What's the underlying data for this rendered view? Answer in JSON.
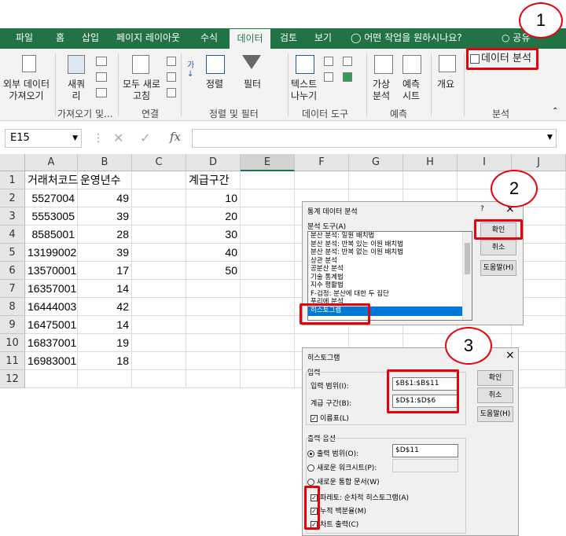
{
  "tabs": [
    "파일",
    "홈",
    "삽입",
    "페이지 레이아웃",
    "수식",
    "데이터",
    "검토",
    "보기"
  ],
  "tell_me": "어떤 작업을 원하시나요?",
  "share": "공유",
  "ribbon": {
    "external_data": "외부 데이터\n가져오기",
    "new_query": "새쿼\n리",
    "refresh_all": "모두 새로\n고침",
    "sort": "정렬",
    "filter": "필터",
    "text_to_columns": "텍스트\n나누기",
    "what_if": "가상\n분석",
    "forecast": "예측\n시트",
    "outline": "개요",
    "data_analysis": "데이터 분석",
    "groups": [
      "가져오기 및...",
      "연결",
      "정렬 및 필터",
      "데이터 도구",
      "예측",
      "분석"
    ]
  },
  "formula_bar": {
    "name_box": "E15",
    "fx": "fx",
    "value": ""
  },
  "columns": [
    "A",
    "B",
    "C",
    "D",
    "E",
    "F",
    "G",
    "H",
    "I",
    "J"
  ],
  "rows": [
    "1",
    "2",
    "3",
    "4",
    "5",
    "6",
    "7",
    "8",
    "9",
    "10",
    "11",
    "12"
  ],
  "cells": {
    "A1": "거래처코드",
    "B1": "운영년수",
    "D1": "계급구간",
    "A": [
      "5527004",
      "5553005",
      "8585001",
      "13199002",
      "13570001",
      "16357001",
      "16444003",
      "16475001",
      "16837001",
      "16983001"
    ],
    "B": [
      "49",
      "39",
      "28",
      "39",
      "17",
      "14",
      "42",
      "14",
      "19",
      "18"
    ],
    "D": [
      "10",
      "20",
      "30",
      "40",
      "50"
    ]
  },
  "analysis_dialog": {
    "title": "통계 데이터 분석",
    "help": "?",
    "close": "×",
    "tools_label": "분석 도구(A)",
    "tools": [
      "분산 분석: 일원 배치법",
      "분산 분석: 반복 있는 이원 배치법",
      "분산 분석: 반복 없는 이원 배치법",
      "상관 분석",
      "공분산 분석",
      "기술 통계법",
      "지수 평활법",
      "F-검정: 분산에 대한 두 집단",
      "푸리에 분석",
      "히스토그램"
    ],
    "selected_tool": "히스토그램",
    "ok": "확인",
    "cancel": "취소",
    "help_btn": "도움말(H)"
  },
  "histogram_dialog": {
    "title": "히스토그램",
    "close": "×",
    "input_section": "입력",
    "input_range_label": "입력 범위(I):",
    "input_range": "$B$1:$B$11",
    "bin_range_label": "계급 구간(B):",
    "bin_range": "$D$1:$D$6",
    "labels": "이름표(L)",
    "output_section": "출력 옵션",
    "output_range_label": "출력 범위(O):",
    "output_range": "$D$11",
    "new_sheet": "새로운 워크시트(P):",
    "new_workbook": "새로운 통합 문서(W)",
    "pareto": "파레토: 순차적 히스토그램(A)",
    "cumulative": "누적 백분율(M)",
    "chart": "차트 출력(C)",
    "ok": "확인",
    "cancel": "취소",
    "help_btn": "도움말(H)"
  },
  "callouts": [
    "1",
    "2",
    "3"
  ],
  "colors": {
    "excel_green": "#217346",
    "annotation_red": "#e8000b",
    "selection_blue": "#0078d7"
  }
}
